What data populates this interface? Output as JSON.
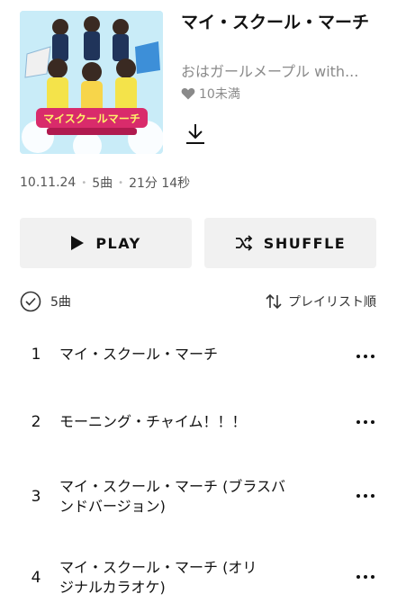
{
  "album": {
    "title": "マイ・スクール・マーチ",
    "artist": "おはガールメープル with...",
    "likes": "10未満",
    "date": "10.11.24",
    "track_count": "5曲",
    "duration": "21分 14秒",
    "cover_art_text": "マイスクールマーチ"
  },
  "actions": {
    "play_label": "PLAY",
    "shuffle_label": "SHUFFLE"
  },
  "list_header": {
    "count_label": "5曲",
    "sort_label": "プレイリスト順"
  },
  "tracks": [
    {
      "number": "1",
      "title": "マイ・スクール・マーチ"
    },
    {
      "number": "2",
      "title": "モーニング・チャイム！！！"
    },
    {
      "number": "3",
      "title": "マイ・スクール・マーチ (ブラスバンドバージョン)"
    },
    {
      "number": "4",
      "title": "マイ・スクール・マーチ (オリジナルカラオケ)"
    }
  ],
  "icons": {
    "heart": "heart-icon",
    "download": "download-icon",
    "play": "play-icon",
    "shuffle": "shuffle-icon",
    "check": "check-circle-icon",
    "sort": "sort-icon",
    "more": "more-icon"
  }
}
